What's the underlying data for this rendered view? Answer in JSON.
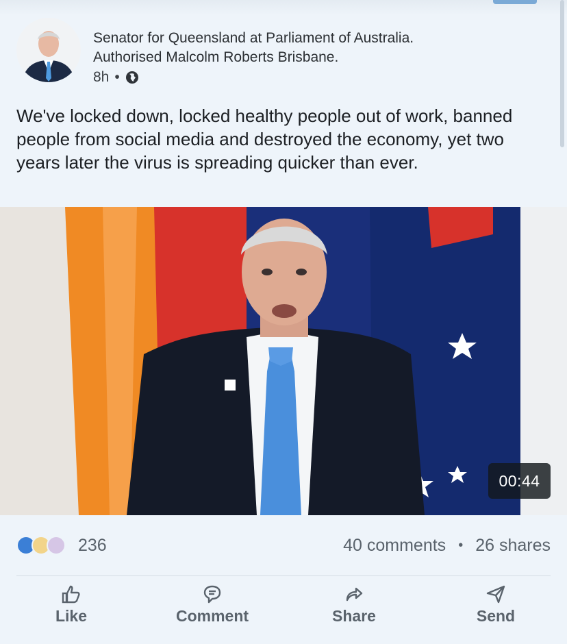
{
  "post": {
    "author_line1": "Senator for Queensland at Parliament of Australia.",
    "author_line2": "Authorised Malcolm Roberts Brisbane.",
    "time": "8h",
    "separator": "•",
    "visibility_icon": "globe-icon",
    "text": "We've locked down, locked healthy people out of work, banned people from social media and destroyed the economy, yet two years later the virus is spreading quicker than ever."
  },
  "video": {
    "duration": "00:44"
  },
  "stats": {
    "reaction_icons": [
      "like-icon",
      "insightful-icon",
      "support-icon"
    ],
    "reactions_count": "236",
    "comments": "40 comments",
    "separator": "•",
    "shares": "26 shares"
  },
  "actions": {
    "like": "Like",
    "comment": "Comment",
    "share": "Share",
    "send": "Send"
  },
  "colors": {
    "background": "#eef4fa",
    "accent": "#3b7fd6",
    "muted_text": "#5a636c"
  }
}
